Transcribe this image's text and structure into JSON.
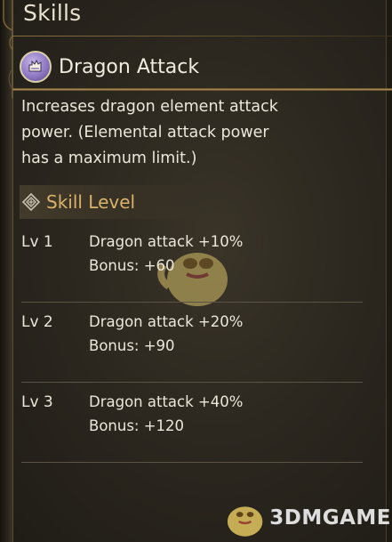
{
  "header": {
    "title": "Skills"
  },
  "skill": {
    "name": "Dragon Attack",
    "description_lines": [
      "Increases dragon element attack",
      "power. (Elemental attack power",
      "has a maximum limit.)"
    ]
  },
  "skill_level": {
    "label": "Skill Level",
    "levels": [
      {
        "lv": "Lv 1",
        "effect": "Dragon attack +10%",
        "bonus": "Bonus: +60"
      },
      {
        "lv": "Lv 2",
        "effect": "Dragon attack +20%",
        "bonus": "Bonus: +90"
      },
      {
        "lv": "Lv 3",
        "effect": "Dragon attack +40%",
        "bonus": "Bonus: +120"
      }
    ]
  },
  "watermark": {
    "text": "3DMGAME"
  },
  "colors": {
    "accent_gold": "#d9b36a",
    "text": "#ece7db",
    "background": "#2c2820",
    "skill_icon": "#8f78c4"
  },
  "icons": {
    "skill_icon": "dragon-attack-skill-icon",
    "level_icon": "skill-level-rune-icon",
    "mascot": "mascot-watermark-icon"
  }
}
